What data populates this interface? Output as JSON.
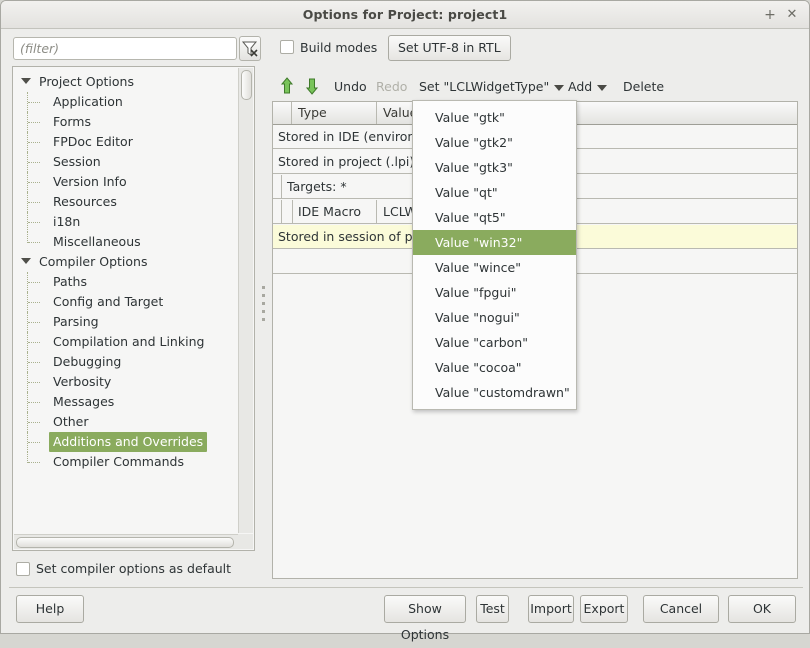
{
  "window": {
    "title": "Options for Project: project1",
    "titlebar_buttons": [
      {
        "name": "maximize",
        "glyph": "+"
      },
      {
        "name": "close",
        "glyph": "✕"
      }
    ]
  },
  "toolbar_top": {
    "filter_placeholder": "(filter)",
    "filter_value": "",
    "filter_clear_icon": "filter-clear-icon",
    "build_modes_label": "Build modes",
    "build_modes_checked": false,
    "utf8_button_label": "Set UTF-8 in RTL"
  },
  "tree": {
    "nodes": [
      {
        "label": "Project Options",
        "level": 0,
        "expanded": true,
        "selected": false
      },
      {
        "label": "Application",
        "level": 1,
        "selected": false
      },
      {
        "label": "Forms",
        "level": 1,
        "selected": false
      },
      {
        "label": "FPDoc Editor",
        "level": 1,
        "selected": false
      },
      {
        "label": "Session",
        "level": 1,
        "selected": false
      },
      {
        "label": "Version Info",
        "level": 1,
        "selected": false
      },
      {
        "label": "Resources",
        "level": 1,
        "selected": false
      },
      {
        "label": "i18n",
        "level": 1,
        "selected": false
      },
      {
        "label": "Miscellaneous",
        "level": 1,
        "selected": false,
        "last": true
      },
      {
        "label": "Compiler Options",
        "level": 0,
        "expanded": true,
        "selected": false
      },
      {
        "label": "Paths",
        "level": 1,
        "selected": false
      },
      {
        "label": "Config and Target",
        "level": 1,
        "selected": false
      },
      {
        "label": "Parsing",
        "level": 1,
        "selected": false
      },
      {
        "label": "Compilation and Linking",
        "level": 1,
        "selected": false
      },
      {
        "label": "Debugging",
        "level": 1,
        "selected": false
      },
      {
        "label": "Verbosity",
        "level": 1,
        "selected": false
      },
      {
        "label": "Messages",
        "level": 1,
        "selected": false
      },
      {
        "label": "Other",
        "level": 1,
        "selected": false
      },
      {
        "label": "Additions and Overrides",
        "level": 1,
        "selected": true
      },
      {
        "label": "Compiler Commands",
        "level": 1,
        "selected": false,
        "last": true
      }
    ]
  },
  "bottom_left": {
    "set_default_label": "Set compiler options as default",
    "set_default_checked": false
  },
  "panel_toolbar": {
    "move_up_icon": "arrow-up-icon",
    "move_down_icon": "arrow-down-icon",
    "undo_label": "Undo",
    "redo_label": "Redo",
    "redo_disabled": true,
    "set_label": "Set \"LCLWidgetType\"",
    "add_label": "Add",
    "delete_label": "Delete"
  },
  "grid": {
    "columns": [
      "",
      "Type",
      "Value",
      ""
    ],
    "rows": [
      {
        "text": "Stored in IDE (environment options)",
        "indent": 0,
        "style": "normal"
      },
      {
        "text": "Stored in project (.lpi)",
        "indent": 0,
        "style": "normal"
      },
      {
        "text": "Targets: *",
        "indent": 1,
        "style": "normal"
      },
      {
        "text": "",
        "indent": 2,
        "style": "macro",
        "cells": [
          "IDE Macro",
          "LCLWidgetType"
        ]
      },
      {
        "text": "Stored in session of project (.lps)",
        "indent": 0,
        "style": "session"
      },
      {
        "text": "",
        "indent": 0,
        "style": "normal"
      }
    ]
  },
  "menu": {
    "items": [
      {
        "label": "Value \"gtk\"",
        "selected": false
      },
      {
        "label": "Value \"gtk2\"",
        "selected": false
      },
      {
        "label": "Value \"gtk3\"",
        "selected": false
      },
      {
        "label": "Value \"qt\"",
        "selected": false
      },
      {
        "label": "Value \"qt5\"",
        "selected": false
      },
      {
        "label": "Value \"win32\"",
        "selected": true
      },
      {
        "label": "Value \"wince\"",
        "selected": false
      },
      {
        "label": "Value \"fpgui\"",
        "selected": false
      },
      {
        "label": "Value \"nogui\"",
        "selected": false
      },
      {
        "label": "Value \"carbon\"",
        "selected": false
      },
      {
        "label": "Value \"cocoa\"",
        "selected": false
      },
      {
        "label": "Value \"customdrawn\"",
        "selected": false
      }
    ]
  },
  "footer": {
    "help": "Help",
    "show_options": "Show Options",
    "test": "Test",
    "import": "Import",
    "export": "Export",
    "cancel": "Cancel",
    "ok": "OK"
  },
  "colors": {
    "selection_green": "#8aab5e",
    "session_yellow": "#fbfbd9",
    "window_bg": "#ededeb",
    "arrow_green": "#5ba03a"
  }
}
